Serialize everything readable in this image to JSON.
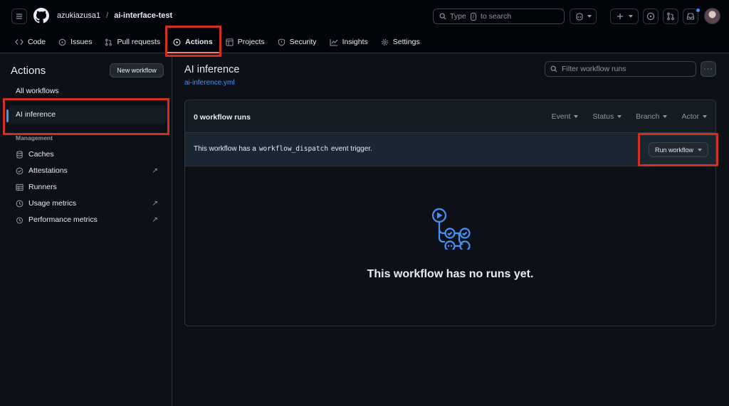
{
  "header": {
    "owner": "azukiazusa1",
    "separator": "/",
    "repo": "ai-interface-test",
    "search": {
      "prefix": "Type",
      "key": "/",
      "suffix": "to search"
    }
  },
  "repo_nav": {
    "tabs": [
      {
        "label": "Code",
        "icon": "code-icon"
      },
      {
        "label": "Issues",
        "icon": "issue-icon"
      },
      {
        "label": "Pull requests",
        "icon": "pull-request-icon"
      },
      {
        "label": "Actions",
        "icon": "play-icon",
        "active": true
      },
      {
        "label": "Projects",
        "icon": "table-icon"
      },
      {
        "label": "Security",
        "icon": "shield-icon"
      },
      {
        "label": "Insights",
        "icon": "graph-icon"
      },
      {
        "label": "Settings",
        "icon": "gear-icon"
      }
    ]
  },
  "sidebar": {
    "title": "Actions",
    "new_workflow": "New workflow",
    "all_workflows": "All workflows",
    "selected_workflow": "AI inference",
    "management_label": "Management",
    "management_items": [
      {
        "label": "Caches",
        "icon": "database-icon",
        "external": false
      },
      {
        "label": "Attestations",
        "icon": "verified-icon",
        "external": true
      },
      {
        "label": "Runners",
        "icon": "server-icon",
        "external": false
      },
      {
        "label": "Usage metrics",
        "icon": "clock-icon",
        "external": true
      },
      {
        "label": "Performance metrics",
        "icon": "stopwatch-icon",
        "external": true
      }
    ]
  },
  "main": {
    "title": "AI inference",
    "file": "ai-inference.yml",
    "filter_placeholder": "Filter workflow runs",
    "more": "···",
    "runs_count": "0 workflow runs",
    "filters": [
      "Event",
      "Status",
      "Branch",
      "Actor"
    ],
    "dispatch": {
      "before": "This workflow has a",
      "code": "workflow_dispatch",
      "after": "event trigger."
    },
    "run_workflow": "Run workflow",
    "empty_message": "This workflow has no runs yet."
  },
  "colors": {
    "background": "#0d1117",
    "header": "#010409",
    "accent_blue": "#4493f8",
    "active_underline": "#f78166",
    "highlight_box": "#d0311f"
  }
}
